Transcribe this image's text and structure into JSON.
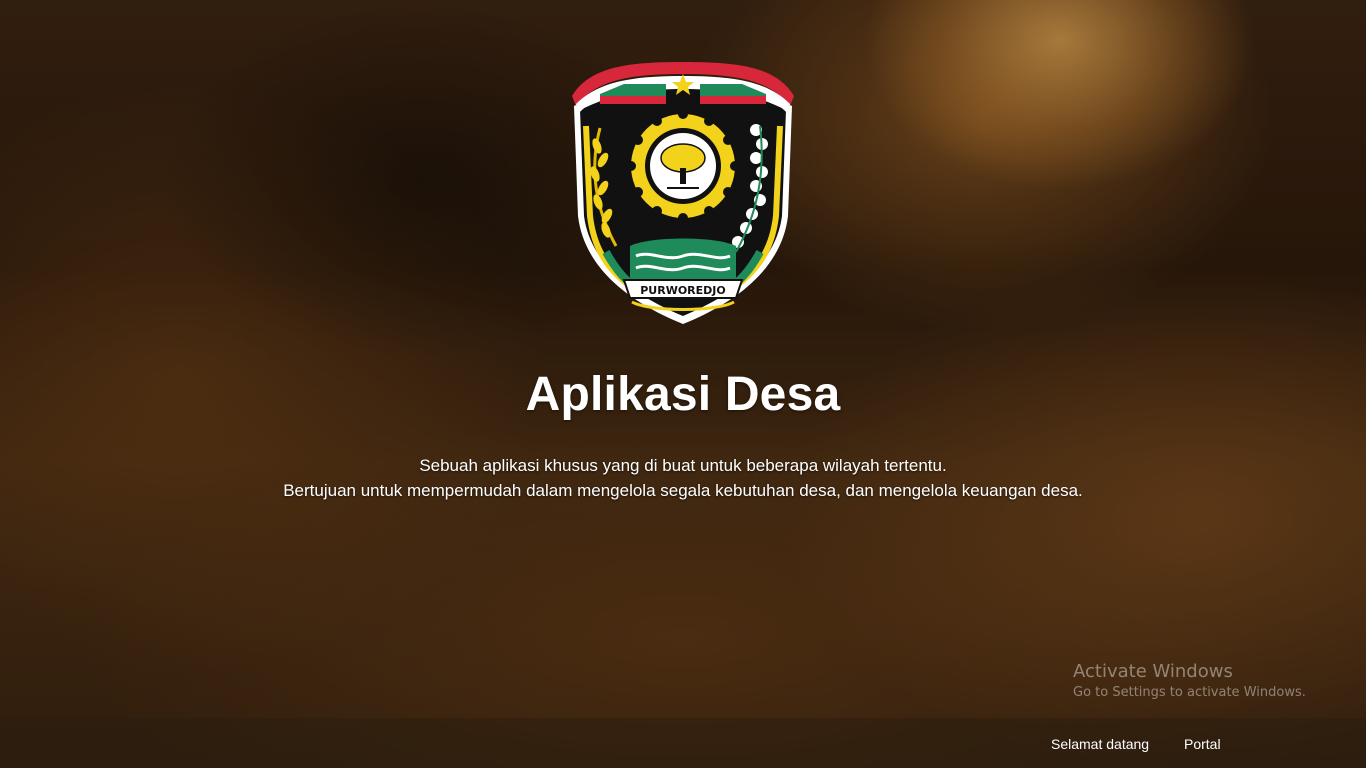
{
  "hero": {
    "logo_text": "PURWOREDJO",
    "title": "Aplikasi Desa",
    "description_line1": "Sebuah aplikasi khusus yang di buat untuk beberapa wilayah tertentu.",
    "description_line2": "Bertujuan untuk mempermudah dalam mengelola segala kebutuhan desa, dan mengelola keuangan desa."
  },
  "footer_nav": {
    "items": [
      {
        "label": "Selamat datang"
      },
      {
        "label": "Portal"
      }
    ]
  },
  "windows_watermark": {
    "title": "Activate Windows",
    "subtitle": "Go to Settings to activate Windows."
  },
  "colors": {
    "title_text": "#ffffff",
    "emblem_gold": "#f2d21a",
    "emblem_red": "#d8263a",
    "emblem_green": "#1f8a5a",
    "emblem_black": "#111111"
  },
  "icons": {
    "logo": "purworejo-regency-emblem"
  }
}
